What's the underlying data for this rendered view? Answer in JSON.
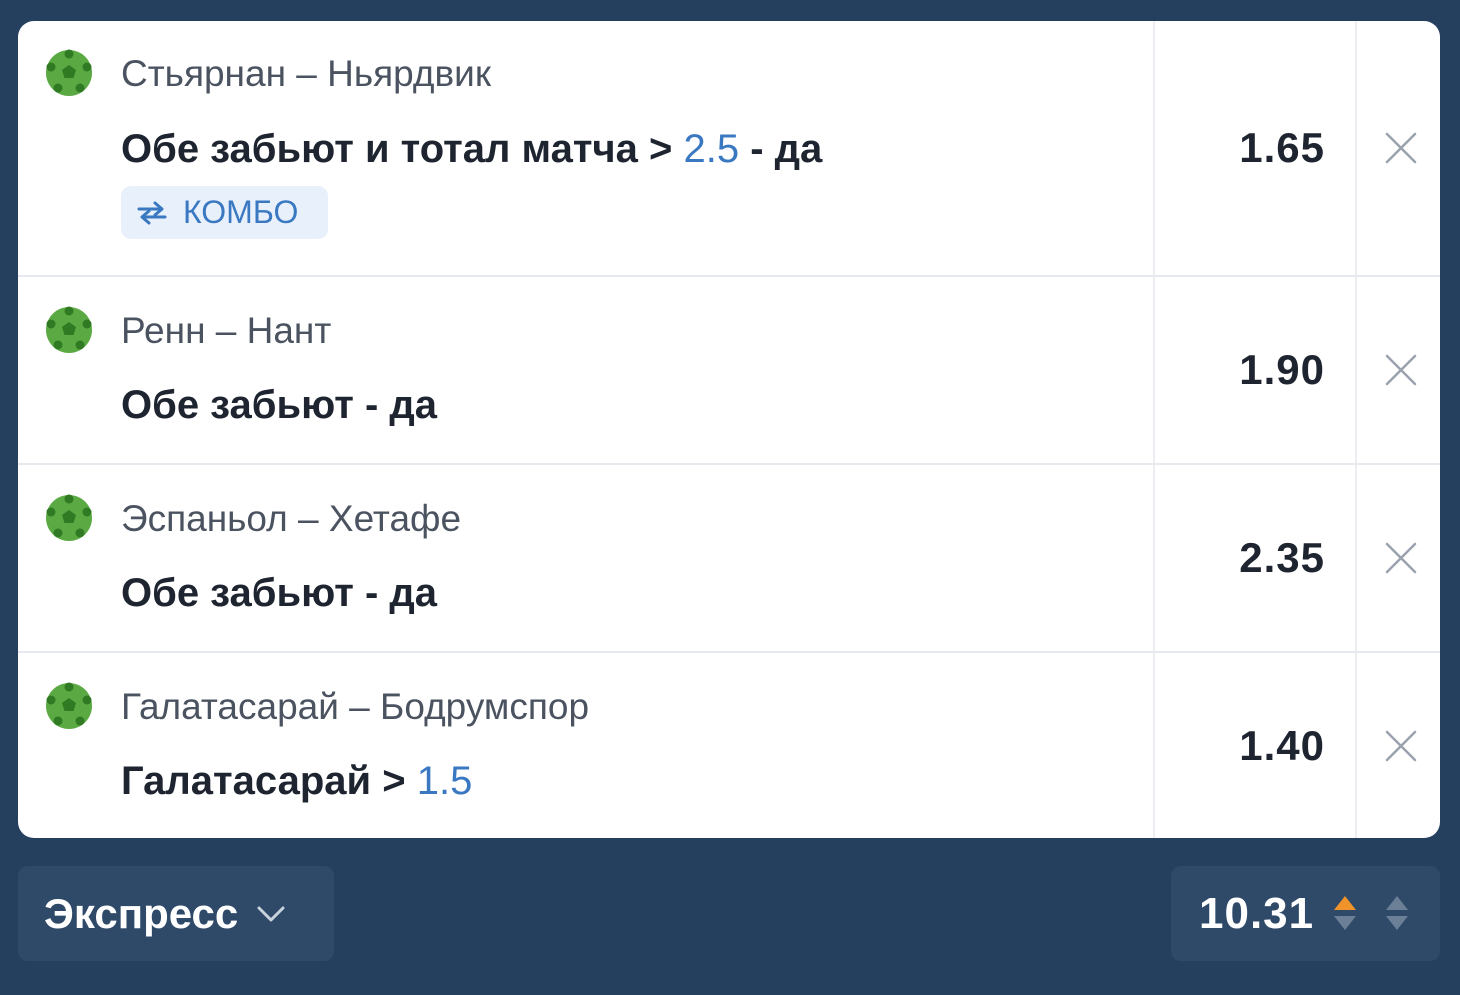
{
  "bets": [
    {
      "match": "Стьярнан – Ньярдвик",
      "market_prefix": "Обе забьют и тотал матча > ",
      "market_value": "2.5",
      "market_suffix": " - да",
      "odds": "1.65",
      "badge": "КОМБО",
      "sport_icon": "soccer-ball-icon"
    },
    {
      "match": "Ренн – Нант",
      "market_prefix": "Обе забьют - да",
      "market_value": "",
      "market_suffix": "",
      "odds": "1.90",
      "sport_icon": "soccer-ball-icon"
    },
    {
      "match": "Эспаньол – Хетафе",
      "market_prefix": "Обе забьют - да",
      "market_value": "",
      "market_suffix": "",
      "odds": "2.35",
      "sport_icon": "soccer-ball-icon"
    },
    {
      "match": "Галатасарай – Бодрумспор",
      "market_prefix": "Галатасарай > ",
      "market_value": "1.5",
      "market_suffix": "",
      "odds": "1.40",
      "sport_icon": "soccer-ball-icon"
    }
  ],
  "footer": {
    "bet_type": "Экспресс",
    "total_odds": "10.31"
  },
  "colors": {
    "background": "#25405f",
    "card": "#ffffff",
    "accent_blue": "#3a78c2",
    "ball_green": "#5aa943",
    "arrow_up_orange": "#f0932b",
    "arrow_gray": "#6b7f96"
  }
}
